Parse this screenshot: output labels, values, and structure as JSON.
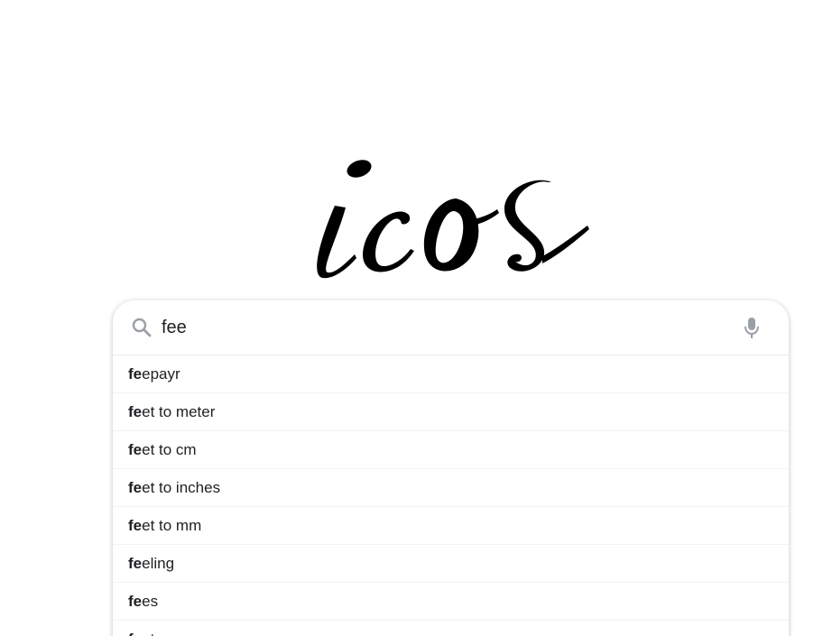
{
  "logo": {
    "text": "icos"
  },
  "search": {
    "value": "fee",
    "typed_prefix": "fe",
    "icon": "search-icon",
    "voice_icon": "microphone-icon"
  },
  "suggestions": [
    {
      "bold": "fe",
      "rest": "epayr"
    },
    {
      "bold": "fe",
      "rest": "et to meter"
    },
    {
      "bold": "fe",
      "rest": "et to cm"
    },
    {
      "bold": "fe",
      "rest": "et to inches"
    },
    {
      "bold": "fe",
      "rest": "et to mm"
    },
    {
      "bold": "fe",
      "rest": "eling"
    },
    {
      "bold": "fe",
      "rest": "es"
    },
    {
      "bold": "fe",
      "rest": "et"
    }
  ],
  "colors": {
    "icon_gray": "#9aa0a6",
    "text": "#202124"
  }
}
